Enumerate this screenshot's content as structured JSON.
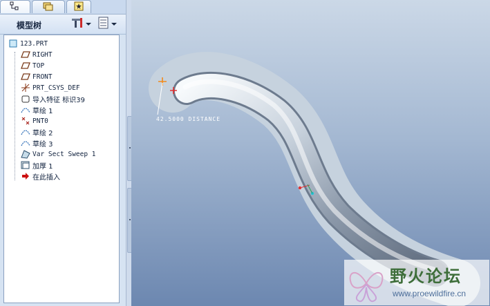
{
  "left_panel": {
    "tabs": [
      {
        "name": "model-tree-tab",
        "icon": "model-tree-icon"
      },
      {
        "name": "folder-browser-tab",
        "icon": "folder-icon"
      },
      {
        "name": "favorites-tab",
        "icon": "favorites-icon"
      }
    ],
    "header_title": "模型树",
    "settings_icon": "tools-icon",
    "show_icon": "list-icon"
  },
  "tree": {
    "root": "123.PRT",
    "items": [
      {
        "label": "RIGHT",
        "icon": "datum-plane-icon"
      },
      {
        "label": "TOP",
        "icon": "datum-plane-icon"
      },
      {
        "label": "FRONT",
        "icon": "datum-plane-icon"
      },
      {
        "label": "PRT_CSYS_DEF",
        "icon": "csys-icon"
      },
      {
        "label": "导入特征 标识39",
        "icon": "import-feature-icon"
      },
      {
        "label": "草绘 1",
        "icon": "sketch-icon"
      },
      {
        "label": "PNT0",
        "icon": "datum-point-icon"
      },
      {
        "label": "草绘 2",
        "icon": "sketch-icon"
      },
      {
        "label": "草绘 3",
        "icon": "sketch-icon"
      },
      {
        "label": "Var Sect Sweep 1",
        "icon": "sweep-icon"
      },
      {
        "label": "加厚 1",
        "icon": "thicken-icon"
      },
      {
        "label": "在此插入",
        "icon": "insert-here-arrow-icon"
      }
    ]
  },
  "viewport": {
    "dimension_label": "42.5000  DISTANCE",
    "watermark_cn": "野火论坛",
    "watermark_url": "www.proewildfire.cn"
  },
  "colors": {
    "panel_bg": "#d6e3f2",
    "viewport_top": "#cbd8e7",
    "viewport_bottom": "#6c87b0",
    "insert_arrow": "#cc1111"
  }
}
